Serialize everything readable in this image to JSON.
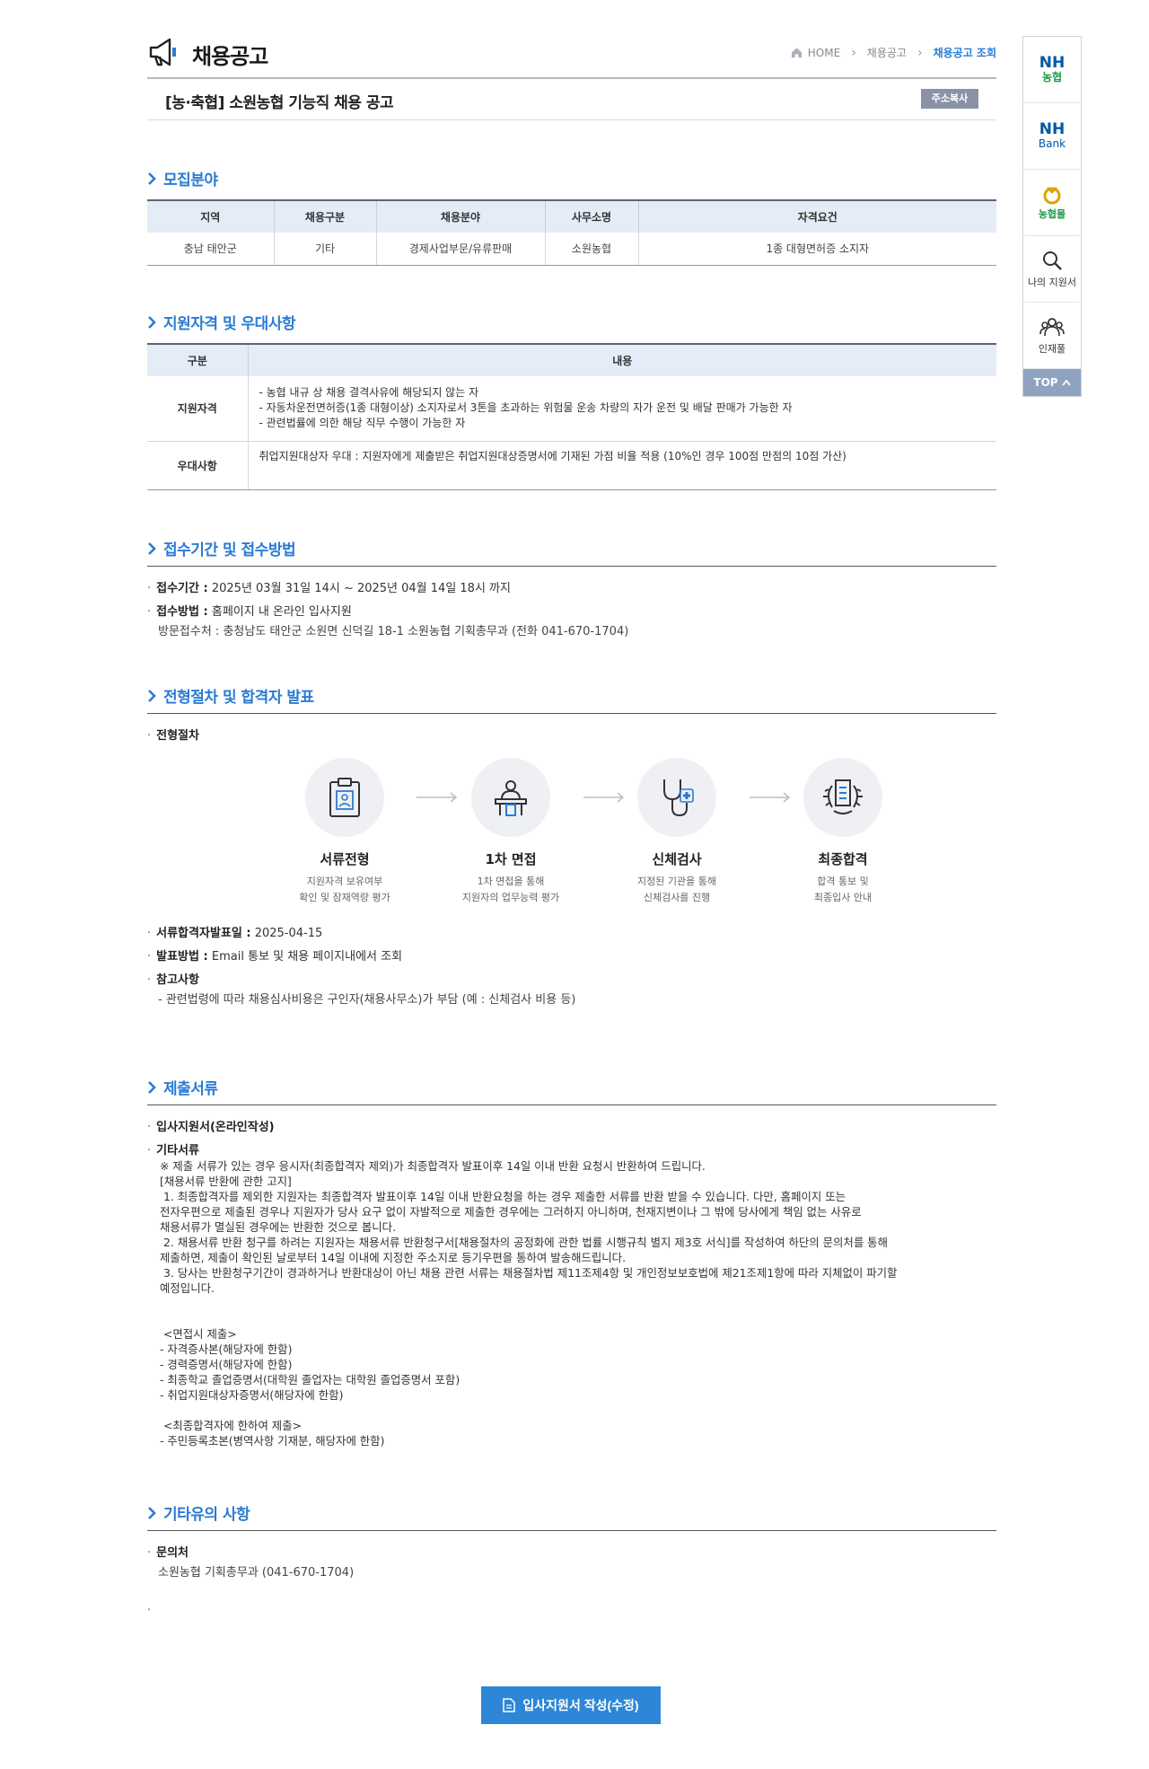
{
  "header": {
    "title": "채용공고",
    "breadcrumb": [
      "HOME",
      "채용공고",
      "채용공고 조회"
    ]
  },
  "job": {
    "title": "[농·축협] 소원농협 기능직 채용 공고",
    "copy_label": "주소복사"
  },
  "recruit": {
    "section_title": "모집분야",
    "columns": [
      "지역",
      "채용구분",
      "채용분야",
      "사무소명",
      "자격요건"
    ],
    "row": [
      "충남 태안군",
      "기타",
      "경제사업부문/유류판매",
      "소원농협",
      "1종 대형면허증 소지자"
    ]
  },
  "qualification": {
    "section_title": "지원자격 및 우대사항",
    "columns": [
      "구분",
      "내용"
    ],
    "rows": [
      {
        "label": "지원자격",
        "lines": [
          "- 농협 내규 상 채용 결격사유에 해당되지 않는 자",
          "- 자동차운전면허증(1종 대형이상) 소지자로서 3톤을 초과하는 위험물 운송 차량의 자가 운전 및 배달 판매가 가능한 자",
          "- 관련법률에 의한 해당 직무 수행이 가능한 자"
        ]
      },
      {
        "label": "우대사항",
        "lines": [
          "취업지원대상자 우대 : 지원자에게 제출받은 취업지원대상증명서에 기재된 가점 비율 적용 (10%인 경우 100점 만점의 10점 가산)"
        ]
      }
    ]
  },
  "reception": {
    "section_title": "접수기간 및 접수방법",
    "period_label": "접수기간 :",
    "period": "2025년 03월 31일 14시 ~ 2025년 04월 14일 18시 까지",
    "method_label": "접수방법 :",
    "method": "홈페이지 내 온라인 입사지원",
    "visit": "방문접수처 : 충청남도 태안군 소원면 신덕길 18-1 소원농협 기획총무과 (전화 041-670-1704)"
  },
  "process": {
    "section_title": "전형절차 및 합격자 발표",
    "label": "전형절차",
    "steps": [
      {
        "name": "서류전형",
        "desc1": "지원자격 보유여부",
        "desc2": "확인 및 잠재역량 평가"
      },
      {
        "name": "1차 면접",
        "desc1": "1차 면접을 통해",
        "desc2": "지원자의 업무능력 평가"
      },
      {
        "name": "신체검사",
        "desc1": "지정된 기관을 통해",
        "desc2": "신체검사를 진행"
      },
      {
        "name": "최종합격",
        "desc1": "합격 통보 및",
        "desc2": "최종입사 안내"
      }
    ],
    "doc_date_label": "서류합격자발표일 :",
    "doc_date": "2025-04-15",
    "announce_label": "발표방법 :",
    "announce": "Email 통보 및 채용 페이지내에서 조회",
    "note_label": "참고사항",
    "note": "- 관련법령에 따라 채용심사비용은 구인자(채용사무소)가 부담 (예 : 신체검사 비용 등)"
  },
  "documents": {
    "section_title": "제출서류",
    "item1": "입사지원서(온라인작성)",
    "item2": "기타서류",
    "body": "※ 제출 서류가 있는 경우 응시자(최종합격자 제외)가 최종합격자 발표이후 14일 이내 반환 요청시 반환하여 드립니다.\n[채용서류 반환에 관한 고지]\n 1. 최종합격자를 제외한 지원자는 최종합격자 발표이후 14일 이내 반환요청을 하는 경우 제출한 서류를 반환 받을 수 있습니다. 다만, 홈페이지 또는\n전자우편으로 제출된 경우나 지원자가 당사 요구 없이 자발적으로 제출한 경우에는 그러하지 아니하며, 천재지변이나 그 밖에 당사에게 책임 없는 사유로\n채용서류가 멸실된 경우에는 반환한 것으로 봅니다.\n 2. 채용서류 반환 청구를 하려는 지원자는 채용서류 반환청구서[채용절차의 공정화에 관한 법률 시행규칙 별지 제3호 서식]를 작성하여 하단의 문의처를 통해\n제출하면, 제출이 확인된 날로부터 14일 이내에 지정한 주소지로 등기우편을 통하여 발송해드립니다.\n 3. 당사는 반환청구기간이 경과하거나 반환대상이 아닌 채용 관련 서류는 채용절차법 제11조제4항 및 개인정보보호법에 제21조제1항에 따라 지체없이 파기할\n예정입니다.\n\n\n <면접시 제출>\n- 자격증사본(해당자에 한함)\n- 경력증명서(해당자에 한함)\n- 최종학교 졸업증명서(대학원 졸업자는 대학원 졸업증명서 포함)\n- 취업지원대상자증명서(해당자에 한함)\n\n <최종합격자에 한하여 제출>\n- 주민등록초본(병역사항 기재분, 해당자에 한함)"
  },
  "etc": {
    "section_title": "기타유의 사항",
    "contact_label": "문의처",
    "contact": "소원농협 기획총무과 (041-670-1704)"
  },
  "submit_label": "입사지원서 작성(수정)",
  "side": {
    "nh_top": "NH",
    "nh_sub": "농협",
    "bank_top": "NH",
    "bank_sub": "Bank",
    "mall": "농협몰",
    "my_apply": "나의 지원서",
    "talent": "인재풀",
    "top": "TOP"
  },
  "colors": {
    "accent": "#2a7bd4",
    "table_head": "#e3ecf7",
    "button": "#2d86d6"
  }
}
